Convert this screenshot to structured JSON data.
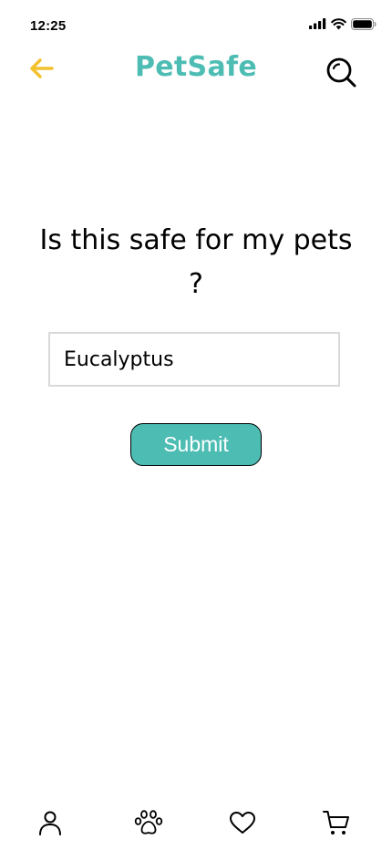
{
  "status_bar": {
    "time": "12:25",
    "icons": [
      "cellular-signal-icon",
      "wifi-icon",
      "battery-icon"
    ]
  },
  "header": {
    "title": "PetSafe",
    "back_icon": "arrow-left-icon",
    "search_icon": "search-icon"
  },
  "main": {
    "question": "Is this safe for my pets ?",
    "input_value": "Eucalyptus",
    "submit_label": "Submit"
  },
  "bottom_nav": {
    "items": [
      {
        "icon": "person-icon"
      },
      {
        "icon": "paw-icon"
      },
      {
        "icon": "heart-icon"
      },
      {
        "icon": "cart-icon"
      }
    ]
  },
  "colors": {
    "brand_teal": "#4dbdb4",
    "back_arrow": "#f2c12e",
    "input_border": "#d9d9d9",
    "text": "#000000"
  }
}
